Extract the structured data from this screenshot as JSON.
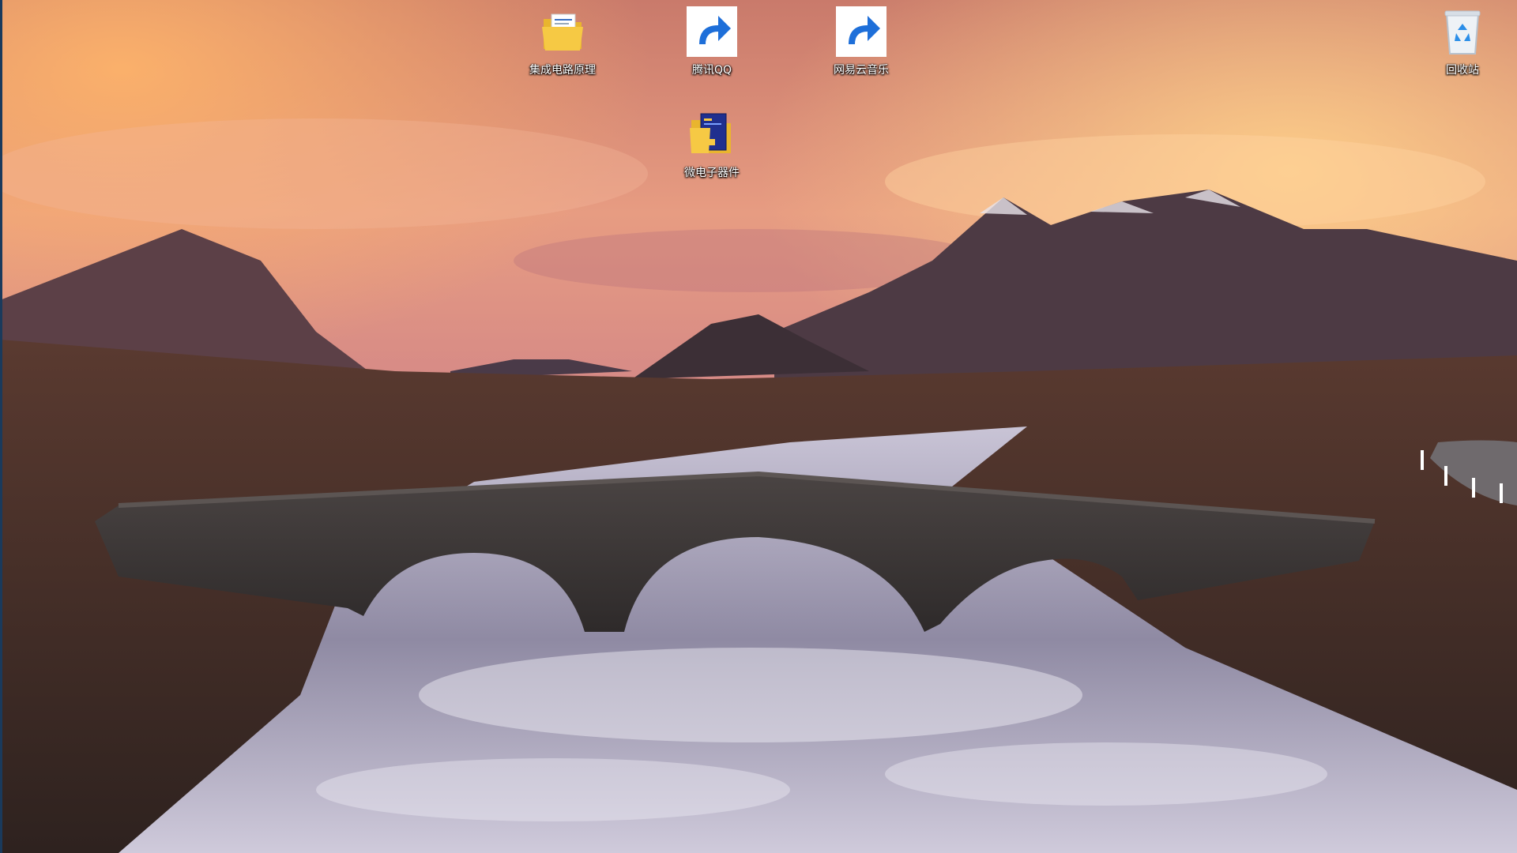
{
  "desktop": {
    "icons": [
      {
        "label": "集成电路原理",
        "icon": "folder-icon",
        "shortcut": false
      },
      {
        "label": "腾讯QQ",
        "icon": "qq-penguin-icon",
        "shortcut": true
      },
      {
        "label": "网易云音乐",
        "icon": "netease-music-icon",
        "shortcut": true
      },
      {
        "label": "回收站",
        "icon": "recycle-bin-icon",
        "shortcut": false
      },
      {
        "label": "微电子器件",
        "icon": "book-folder-icon",
        "shortcut": false
      }
    ]
  },
  "colors": {
    "netease_red": "#e3262b",
    "folder_yellow": "#f6c944",
    "book_blue": "#1f2f8f"
  }
}
